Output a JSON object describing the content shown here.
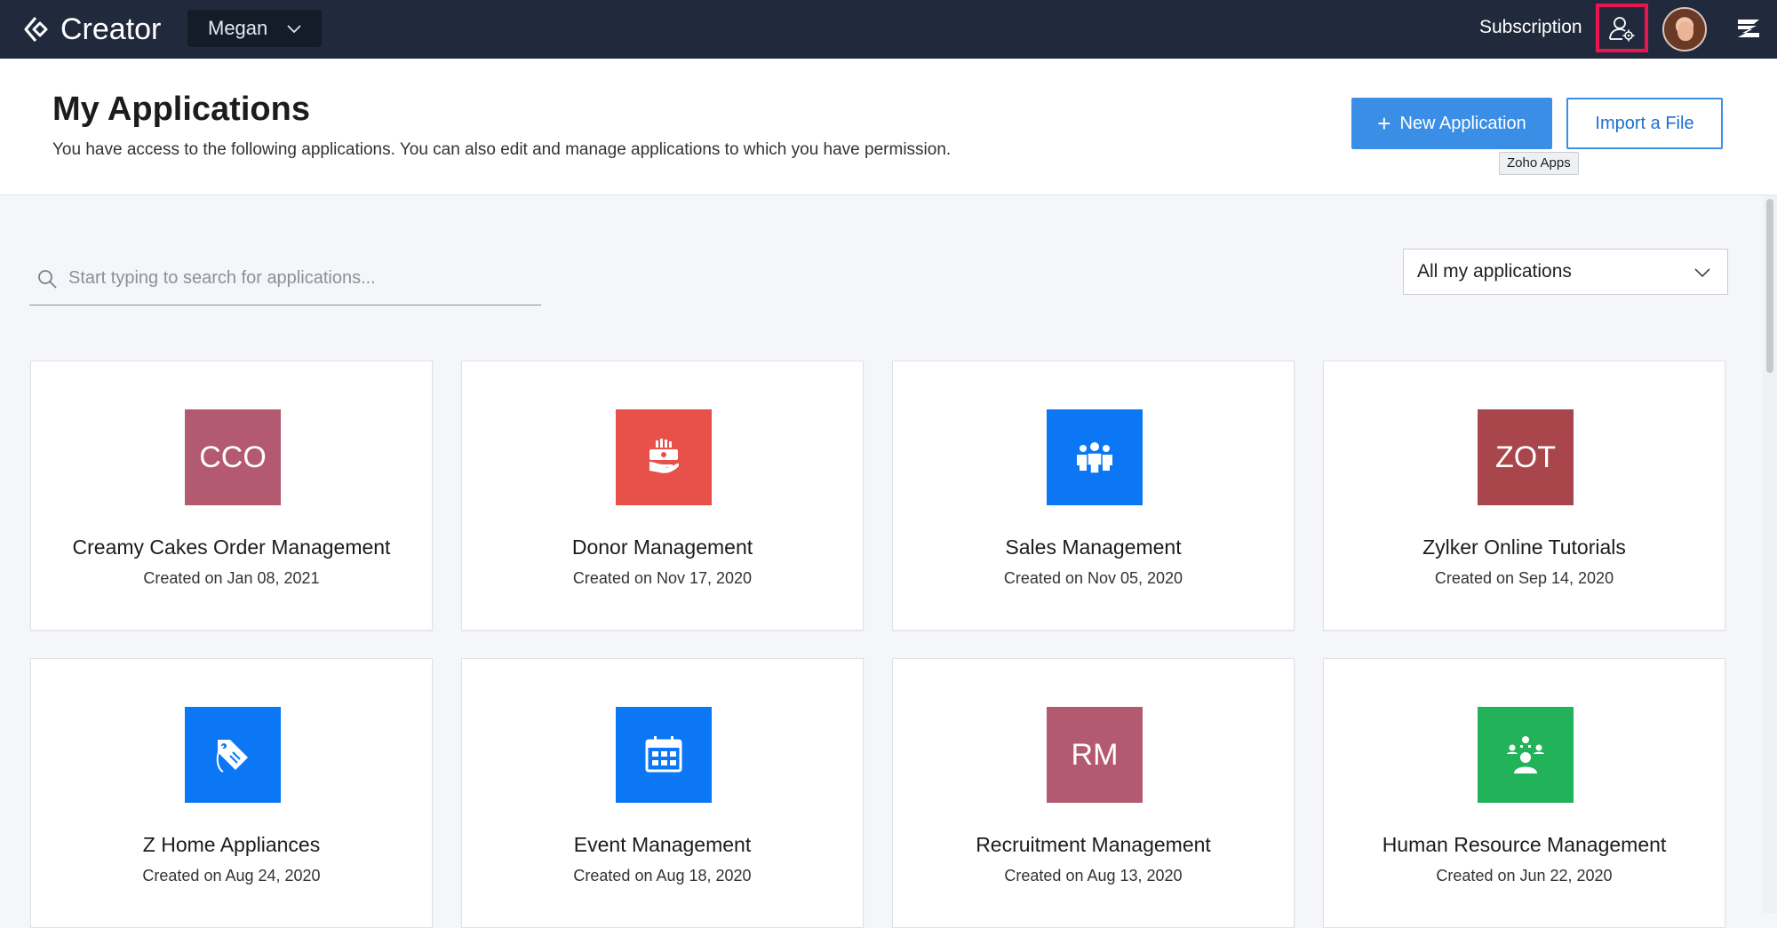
{
  "topbar": {
    "app_name": "Creator",
    "workspace": "Megan",
    "subscription_label": "Subscription",
    "icons": {
      "logo": "creator-logo-icon",
      "zoho_apps": "user-gear-icon",
      "menu": "zoho-z-menu-icon"
    }
  },
  "header": {
    "title": "My Applications",
    "subtitle": "You have access to the following applications. You can also edit and manage applications to which you have permission.",
    "new_app_label": "New Application",
    "import_label": "Import a File",
    "tooltip": "Zoho Apps"
  },
  "search": {
    "placeholder": "Start typing to search for applications..."
  },
  "filter": {
    "selected": "All my applications"
  },
  "apps": [
    {
      "name": "Creamy Cakes Order Management",
      "date": "Created on Jan 08, 2021",
      "icon_text": "CCO",
      "icon": "initials",
      "color": "#b35a70"
    },
    {
      "name": "Donor Management",
      "date": "Created on Nov 17, 2020",
      "icon_text": "",
      "icon": "donation-hand-icon",
      "color": "#e8504a"
    },
    {
      "name": "Sales Management",
      "date": "Created on Nov 05, 2020",
      "icon_text": "",
      "icon": "people-group-icon",
      "color": "#0b77f5"
    },
    {
      "name": "Zylker Online Tutorials",
      "date": "Created on Sep 14, 2020",
      "icon_text": "ZOT",
      "icon": "initials",
      "color": "#a8464c"
    },
    {
      "name": "Z Home Appliances",
      "date": "Created on Aug 24, 2020",
      "icon_text": "",
      "icon": "price-tag-icon",
      "color": "#0b77f5"
    },
    {
      "name": "Event Management",
      "date": "Created on Aug 18, 2020",
      "icon_text": "",
      "icon": "calendar-icon",
      "color": "#0b77f5"
    },
    {
      "name": "Recruitment Management",
      "date": "Created on Aug 13, 2020",
      "icon_text": "RM",
      "icon": "initials",
      "color": "#b35a70"
    },
    {
      "name": "Human Resource Management",
      "date": "Created on Jun 22, 2020",
      "icon_text": "",
      "icon": "team-presenter-icon",
      "color": "#22b25a"
    }
  ]
}
